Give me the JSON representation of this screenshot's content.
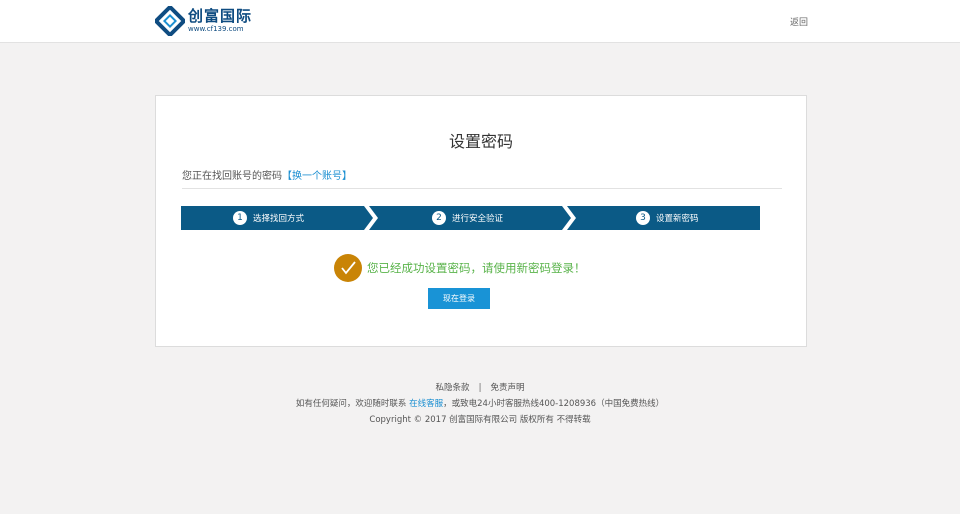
{
  "header": {
    "logo_name": "创富国际",
    "logo_url": "www.cf139.com",
    "back_label": "返回"
  },
  "main": {
    "title": "设置密码",
    "account_prefix": "您正在找回账号的密码",
    "switch_account": "【换一个账号】",
    "steps": [
      {
        "number": "1",
        "label": "选择找回方式"
      },
      {
        "number": "2",
        "label": "进行安全验证"
      },
      {
        "number": "3",
        "label": "设置新密码"
      }
    ],
    "success_message": "您已经成功设置密码，请使用新密码登录！",
    "login_button": "现在登录"
  },
  "footer": {
    "privacy": "私隐条款",
    "separator": "|",
    "disclaimer": "免责声明",
    "contact_prefix": "如有任何疑问，欢迎随时联系",
    "online_service": "在线客服",
    "contact_suffix": "，或致电24小时客服热线400-1208936（中国免费热线）",
    "copyright": "Copyright © 2017 创富国际有限公司 版权所有 不得转载"
  },
  "colors": {
    "brand": "#0f4c81",
    "step_bar": "#0b5a86",
    "link": "#1b8fd1",
    "success_text": "#59b34a",
    "check_icon": "#c98406",
    "button": "#1993d6"
  }
}
